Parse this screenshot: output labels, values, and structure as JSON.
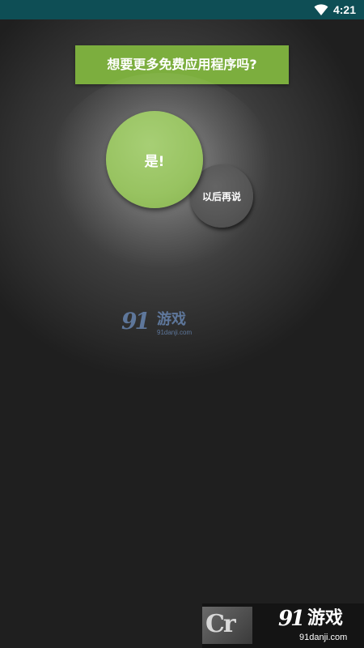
{
  "status_bar": {
    "time": "4:21",
    "icon": "wifi-icon"
  },
  "dialog": {
    "title": "想要更多免费应用程序吗?",
    "yes_label": "是!",
    "later_label": "以后再说"
  },
  "watermark_center": {
    "logo": "91",
    "name": "游戏",
    "url": "91danji.com"
  },
  "watermark_bottom": {
    "cr_text": "Cr",
    "logo": "91",
    "name": "游戏",
    "url": "91danji.com"
  },
  "colors": {
    "status_bar": "#0e4e55",
    "banner": "#7cae3e",
    "yes_button": "#98c361",
    "later_button": "#555555"
  }
}
